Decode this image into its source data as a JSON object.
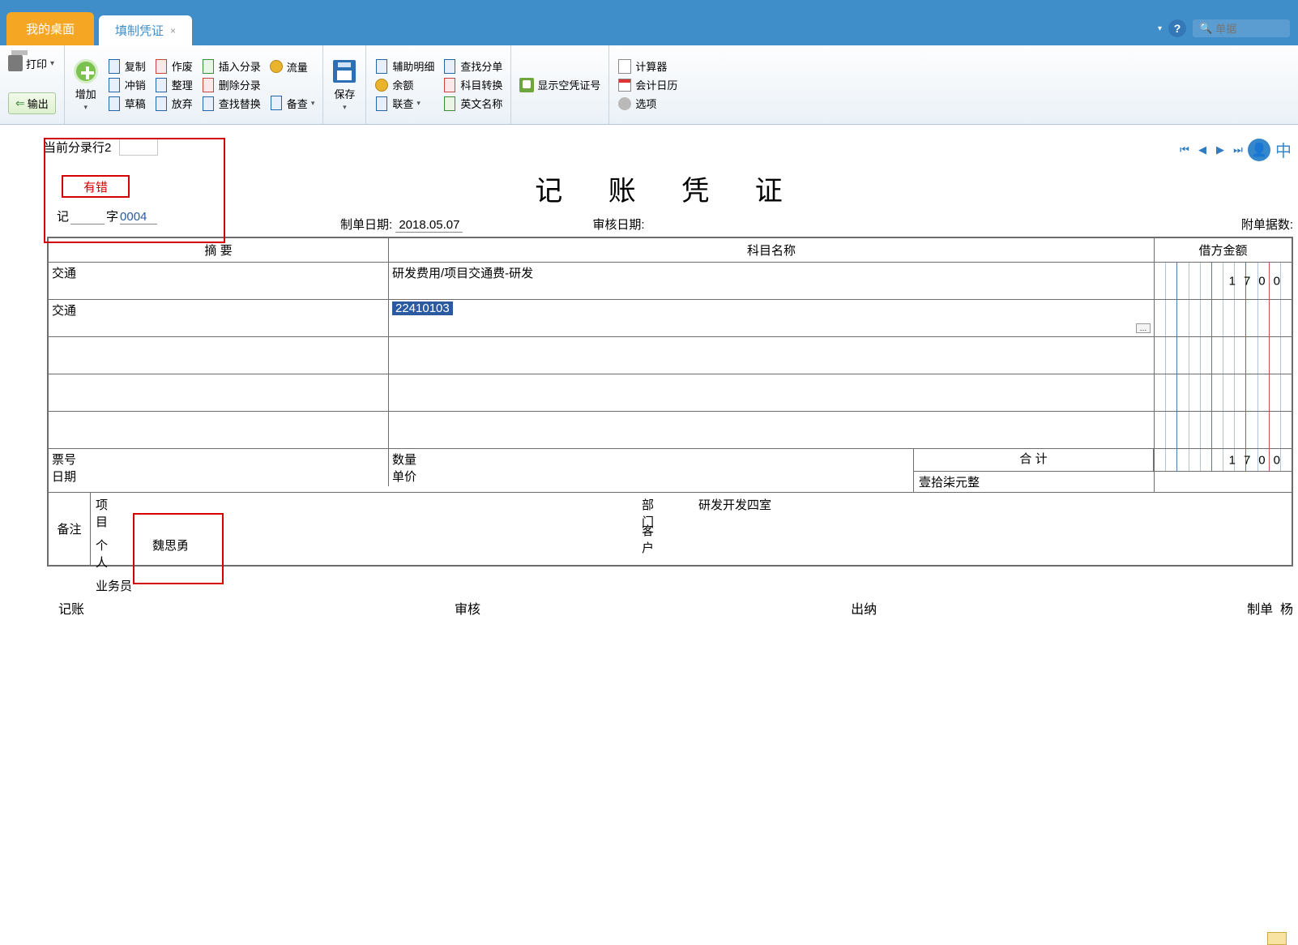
{
  "topbar": {
    "hint": ""
  },
  "tabs": {
    "desktop": "我的桌面",
    "voucher": "填制凭证"
  },
  "tabtools": {
    "search_placeholder": "单据"
  },
  "ribbon": {
    "print": "打印",
    "export": "输出",
    "add": "增加",
    "copy": "复制",
    "reverse": "冲销",
    "draft": "草稿",
    "void": "作废",
    "tidy": "整理",
    "abandon": "放弃",
    "insert_entry": "插入分录",
    "delete_entry": "删除分录",
    "find_replace": "查找替换",
    "flow": "流量",
    "backup": "备查",
    "save": "保存",
    "aux_detail": "辅助明细",
    "balance": "余额",
    "related": "联查",
    "find_entry": "查找分单",
    "subject_convert": "科目转换",
    "english_name": "英文名称",
    "show_empty_no": "显示空凭证号",
    "calculator": "计算器",
    "acct_calendar": "会计日历",
    "options": "选项"
  },
  "pager": {
    "zhong": "中"
  },
  "doc": {
    "curline_label": "当前分录行2",
    "error_btn": "有错",
    "word_prefix": "记",
    "word_zi": "字",
    "number": "0004",
    "title": "记 账 凭 证",
    "make_date_label": "制单日期:",
    "make_date": "2018.05.07",
    "audit_date_label": "审核日期:",
    "attach_label": "附单据数:"
  },
  "grid": {
    "col_summary": "摘 要",
    "col_subject": "科目名称",
    "col_debit": "借方金额",
    "rows": [
      {
        "summary": "交通",
        "subject": "研发费用/项目交通费-研发",
        "debit": "1700"
      },
      {
        "summary": "交通",
        "subject_code": "22410103",
        "debit": ""
      },
      {
        "summary": "",
        "subject": "",
        "debit": ""
      },
      {
        "summary": "",
        "subject": "",
        "debit": ""
      },
      {
        "summary": "",
        "subject": "",
        "debit": ""
      }
    ]
  },
  "footer": {
    "ticket_no": "票号",
    "date_label": "日期",
    "qty": "数量",
    "price": "单价",
    "total_label": "合 计",
    "total_amount": "1700",
    "total_cn": "壹拾柒元整"
  },
  "remarks": {
    "label": "备注",
    "project": "项 目",
    "person": "个 人",
    "person_val": "魏思勇",
    "agent": "业务员",
    "dept": "部 门",
    "dept_val": "研发开发四室",
    "customer": "客 户"
  },
  "signs": {
    "book": "记账",
    "audit": "审核",
    "cashier": "出纳",
    "maker": "制单",
    "maker_name": "杨"
  }
}
